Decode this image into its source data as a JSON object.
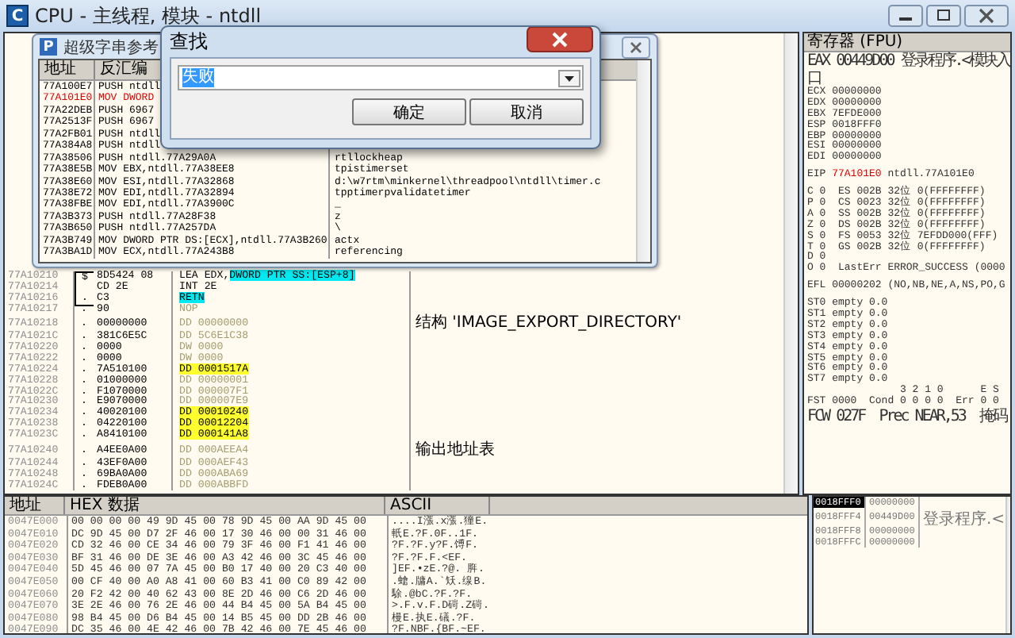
{
  "window": {
    "icon_letter": "C",
    "title": "CPU - 主线程, 模块 - ntdll"
  },
  "disassembly": {
    "rows": [
      {
        "address": "77A10210",
        "kind": "open",
        "mark": "$",
        "hex": "8D5424 08",
        "code": [
          {
            "text": "LEA EDX,"
          },
          {
            "text": "DWORD PTR SS:[ESP+8]",
            "color": "#00e8f0"
          }
        ],
        "dim": false
      },
      {
        "address": "77A10214",
        "kind": "inside",
        "hex": "CD 2E",
        "code": [
          {
            "text": "INT 2E"
          }
        ],
        "dim": false
      },
      {
        "address": "77A10216",
        "kind": "close",
        "mark": ".",
        "hex": "C3",
        "code": [
          {
            "text": "RETN",
            "color": "#00e8f0"
          }
        ],
        "dim": false
      },
      {
        "address": "77A10217",
        "mark": ".",
        "hex": "90",
        "code": [
          {
            "text": "NOP"
          }
        ],
        "dim": true
      },
      {
        "address": "77A10218",
        "mark": ".",
        "hex": "00000000",
        "code": [
          {
            "text": "DD 00000000"
          }
        ],
        "dim": true,
        "comment": "结构 'IMAGE_EXPORT_DIRECTORY'"
      },
      {
        "address": "77A1021C",
        "mark": ".",
        "hex": "381C6E5C",
        "code": [
          {
            "text": "DD 5C6E1C38"
          }
        ],
        "dim": true
      },
      {
        "address": "77A10220",
        "mark": ".",
        "hex": "0000",
        "code": [
          {
            "text": "DW 0000"
          }
        ],
        "dim": true
      },
      {
        "address": "77A10222",
        "mark": ".",
        "hex": "0000",
        "code": [
          {
            "text": "DW 0000"
          }
        ],
        "dim": true
      },
      {
        "address": "77A10224",
        "mark": ".",
        "hex": "7A510100",
        "code": [
          {
            "text": "DD 0001517A",
            "color": "#ffff30"
          }
        ],
        "dim": false
      },
      {
        "address": "77A10228",
        "mark": ".",
        "hex": "01000000",
        "code": [
          {
            "text": "DD 00000001"
          }
        ],
        "dim": true
      },
      {
        "address": "77A1022C",
        "mark": ".",
        "hex": "F1070000",
        "code": [
          {
            "text": "DD 000007F1"
          }
        ],
        "dim": true
      },
      {
        "address": "77A10230",
        "mark": ".",
        "hex": "E9070000",
        "code": [
          {
            "text": "DD 000007E9"
          }
        ],
        "dim": true
      },
      {
        "address": "77A10234",
        "mark": ".",
        "hex": "40020100",
        "code": [
          {
            "text": "DD 00010240",
            "color": "#ffff30"
          }
        ],
        "dim": false
      },
      {
        "address": "77A10238",
        "mark": ".",
        "hex": "04220100",
        "code": [
          {
            "text": "DD 00012204",
            "color": "#ffff30"
          }
        ],
        "dim": false
      },
      {
        "address": "77A1023C",
        "mark": ".",
        "hex": "A8410100",
        "code": [
          {
            "text": "DD 000141A8",
            "color": "#ffff30"
          }
        ],
        "dim": false
      },
      {
        "address": "77A10240",
        "mark": ".",
        "hex": "A4EE0A00",
        "code": [
          {
            "text": "DD 000AEEA4"
          }
        ],
        "dim": true,
        "comment": "输出地址表"
      },
      {
        "address": "77A10244",
        "mark": ".",
        "hex": "43EF0A00",
        "code": [
          {
            "text": "DD 000AEF43"
          }
        ],
        "dim": true
      },
      {
        "address": "77A10248",
        "mark": ".",
        "hex": "69BA0A00",
        "code": [
          {
            "text": "DD 000ABA69"
          }
        ],
        "dim": true
      },
      {
        "address": "77A1024C",
        "mark": ".",
        "hex": "FDEB0A00",
        "code": [
          {
            "text": "DD 000ABBFD"
          }
        ],
        "dim": true
      }
    ]
  },
  "registers": {
    "title": "寄存器 (FPU)",
    "lines": [
      {
        "kind": "wide",
        "text": "EAX 00449D00 登录程序.<模块入口"
      },
      {
        "kind": "text",
        "text": "ECX 00000000"
      },
      {
        "kind": "text",
        "text": "EDX 00000000"
      },
      {
        "kind": "text",
        "text": "EBX 7EFDE000"
      },
      {
        "kind": "text",
        "text": "ESP 0018FFF0"
      },
      {
        "kind": "text",
        "text": "EBP 00000000"
      },
      {
        "kind": "text",
        "text": "ESI 00000000"
      },
      {
        "kind": "text",
        "text": "EDI 00000000"
      },
      {
        "kind": "gap"
      },
      {
        "kind": "eip",
        "label": "EIP",
        "value": "77A101E0",
        "note": "ntdll.77A101E0"
      },
      {
        "kind": "gap"
      },
      {
        "kind": "text",
        "text": "C 0  ES 002B 32位 0(FFFFFFFF)"
      },
      {
        "kind": "text",
        "text": "P 0  CS 0023 32位 0(FFFFFFFF)"
      },
      {
        "kind": "text",
        "text": "A 0  SS 002B 32位 0(FFFFFFFF)"
      },
      {
        "kind": "text",
        "text": "Z 0  DS 002B 32位 0(FFFFFFFF)"
      },
      {
        "kind": "text",
        "text": "S 0  FS 0053 32位 7EFDD000(FFF)"
      },
      {
        "kind": "text",
        "text": "T 0  GS 002B 32位 0(FFFFFFFF)"
      },
      {
        "kind": "text",
        "text": "D 0"
      },
      {
        "kind": "text",
        "text": "O 0  LastErr ERROR_SUCCESS (0000"
      },
      {
        "kind": "gap"
      },
      {
        "kind": "text",
        "text": "EFL 00000202 (NO,NB,NE,A,NS,PO,G"
      },
      {
        "kind": "gap"
      },
      {
        "kind": "text",
        "text": "ST0 empty 0.0"
      },
      {
        "kind": "text",
        "text": "ST1 empty 0.0"
      },
      {
        "kind": "text",
        "text": "ST2 empty 0.0"
      },
      {
        "kind": "text",
        "text": "ST3 empty 0.0"
      },
      {
        "kind": "text",
        "text": "ST4 empty 0.0"
      },
      {
        "kind": "text",
        "text": "ST5 empty 0.0"
      },
      {
        "kind": "text",
        "text": "ST6 empty 0.0"
      },
      {
        "kind": "text",
        "text": "ST7 empty 0.0"
      },
      {
        "kind": "text",
        "text": "               3 2 1 0      E S"
      },
      {
        "kind": "text",
        "text": "FST 0000  Cond 0 0 0 0  Err 0 0"
      },
      {
        "kind": "wide",
        "text": "FCW 027F  Prec NEAR,53  掩码"
      }
    ]
  },
  "dump": {
    "columns": [
      "地址",
      "HEX 数据",
      "ASCII"
    ],
    "rows": [
      {
        "address": "0047E000",
        "hex": "00 00 00 00 49 9D 45 00 78 9D 45 00 AA 9D 45 00",
        "ascii": "....I漲.x漲.獞E."
      },
      {
        "address": "0047E010",
        "hex": "DC 9D 45 00 D7 2F 46 00 17 30 46 00 00 31 46 00",
        "ascii": "軝E.?F.0F..1F."
      },
      {
        "address": "0047E020",
        "hex": "CD 32 46 00 CE 34 46 00 79 3F 46 00 F1 41 46 00",
        "ascii": "?F.?F.y?F.馎F."
      },
      {
        "address": "0047E030",
        "hex": "BF 31 46 00 DE 3E 46 00 A3 42 46 00 3C 45 46 00",
        "ascii": "?F.?F.F.<EF."
      },
      {
        "address": "0047E040",
        "hex": "5D 45 46 00 07 7A 45 00 B0 17 40 00 20 C3 40 00",
        "ascii": "]EF.•zE.?@. 脌."
      },
      {
        "address": "0047E050",
        "hex": "00 CF 40 00 A0 A8 41 00 60 B3 41 00 C0 89 42 00",
        "ascii": ".螥.牗A.`矨.缐B."
      },
      {
        "address": "0047E060",
        "hex": "20 F2 42 00 40 62 43 00 8E 2D 46 00 C6 2D 46 00",
        "ascii": " 駼.@bC.?F.?F."
      },
      {
        "address": "0047E070",
        "hex": "3E 2E 46 00 76 2E 46 00 44 B4 45 00 5A B4 45 00",
        "ascii": ">.F.v.F.D碋.Z碋."
      },
      {
        "address": "0047E080",
        "hex": "98 B4 45 00 D6 B4 45 00 14 B5 45 00 DD 2B 46 00",
        "ascii": "槾E.执E.礒.?F."
      },
      {
        "address": "0047E090",
        "hex": "DC 35 46 00 4E 42 46 00 7B 42 46 00 7E 45 46 00",
        "ascii": "?F.NBF.{BF.~EF."
      }
    ]
  },
  "stack": {
    "rows": [
      {
        "address": "0018FFF0",
        "value": "00000000",
        "selected": true
      },
      {
        "address": "0018FFF4",
        "value": "00449D00",
        "comment": "登录程序.<",
        "selected": false
      },
      {
        "address": "0018FFF8",
        "value": "00000000",
        "selected": false
      },
      {
        "address": "0018FFFC",
        "value": "00000000",
        "selected": false
      }
    ]
  },
  "string_window": {
    "icon_letter": "P",
    "title": "超级字串参考",
    "columns": [
      "地址",
      "反汇编"
    ],
    "rows": [
      {
        "address": "77A100E7",
        "code": "PUSH ntdll",
        "selected": false
      },
      {
        "address": "77A101E0",
        "code": "MOV DWORD",
        "selected": true
      },
      {
        "address": "77A22DEB",
        "code": "PUSH 6967",
        "selected": false
      },
      {
        "address": "77A2513F",
        "code": "PUSH 6967",
        "selected": false
      },
      {
        "address": "77A2FB01",
        "code": "PUSH ntdll",
        "selected": false
      },
      {
        "address": "77A384A8",
        "code": "PUSH ntdll",
        "selected": false
      },
      {
        "address": "77A38506",
        "code": "PUSH ntdll.77A29A0A",
        "text": "rtllockheap",
        "selected": false
      },
      {
        "address": "77A38E5B",
        "code": "MOV EBX,ntdll.77A38EE8",
        "text": "tpistimerset",
        "selected": false
      },
      {
        "address": "77A38E60",
        "code": "MOV ESI,ntdll.77A32868",
        "text": "d:\\w7rtm\\minkernel\\threadpool\\ntdll\\timer.c",
        "selected": false
      },
      {
        "address": "77A38E72",
        "code": "MOV EDI,ntdll.77A32894",
        "text": "tpptimerpvalidatetimer",
        "selected": false
      },
      {
        "address": "77A38FBE",
        "code": "MOV EDI,ntdll.77A3900C",
        "text": "_",
        "selected": false
      },
      {
        "address": "77A3B373",
        "code": "PUSH ntdll.77A28F38",
        "text": "z",
        "selected": false
      },
      {
        "address": "77A3B650",
        "code": "PUSH ntdll.77A257DA",
        "text": "\\",
        "selected": false
      },
      {
        "address": "77A3B749",
        "code": "MOV DWORD PTR DS:[ECX],ntdll.77A3B260",
        "text": "actx",
        "selected": false
      },
      {
        "address": "77A3BA1D",
        "code": "MOV ECX,ntdll.77A243B8",
        "text": "referencing",
        "selected": false
      }
    ]
  },
  "find_dialog": {
    "title": "查找",
    "value": "失败",
    "buttons": [
      "确定",
      "取消"
    ]
  }
}
